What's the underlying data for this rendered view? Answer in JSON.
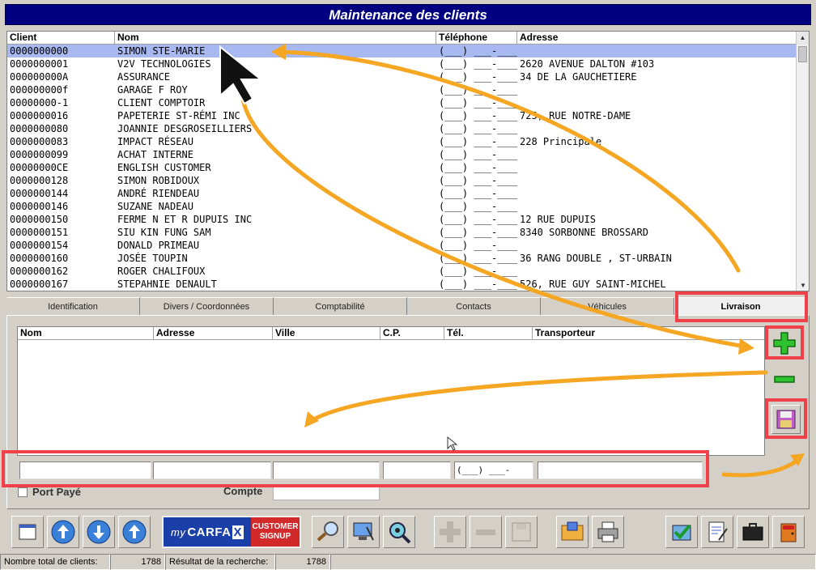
{
  "window": {
    "title": "Maintenance des clients"
  },
  "client_grid": {
    "columns": [
      "Client",
      "Nom",
      "Téléphone",
      "Adresse"
    ],
    "rows": [
      {
        "client": "0000000000",
        "nom": "SIMON STE-MARIE",
        "tel": "(___) ___-____",
        "adresse": ""
      },
      {
        "client": "0000000001",
        "nom": "V2V TECHNOLOGIES",
        "tel": "(___) ___-____",
        "adresse": "2620 AVENUE DALTON #103"
      },
      {
        "client": "000000000A",
        "nom": "ASSURANCE",
        "tel": "(___) ___-____",
        "adresse": "34 DE LA GAUCHETIERE"
      },
      {
        "client": "000000000f",
        "nom": "GARAGE F ROY",
        "tel": "(___) ___-____",
        "adresse": ""
      },
      {
        "client": "00000000-1",
        "nom": "CLIENT COMPTOIR",
        "tel": "(___) ___-____",
        "adresse": ""
      },
      {
        "client": "0000000016",
        "nom": "PAPETERIE ST-RÉMI INC",
        "tel": "(___) ___-____",
        "adresse": "725, RUE NOTRE-DAME"
      },
      {
        "client": "0000000080",
        "nom": "JOANNIE DESGROSEILLIERS",
        "tel": "(___) ___-____",
        "adresse": ""
      },
      {
        "client": "0000000083",
        "nom": "IMPACT RÉSEAU",
        "tel": "(___) ___-____",
        "adresse": "228 Principale"
      },
      {
        "client": "0000000099",
        "nom": "ACHAT INTERNE",
        "tel": "(___) ___-____",
        "adresse": ""
      },
      {
        "client": "00000000CE",
        "nom": "ENGLISH CUSTOMER",
        "tel": "(___) ___-____",
        "adresse": ""
      },
      {
        "client": "0000000128",
        "nom": "SIMON ROBIDOUX",
        "tel": "(___) ___-____",
        "adresse": ""
      },
      {
        "client": "0000000144",
        "nom": "ANDRÉ RIENDEAU",
        "tel": "(___) ___-____",
        "adresse": ""
      },
      {
        "client": "0000000146",
        "nom": "SUZANE NADEAU",
        "tel": "(___) ___-____",
        "adresse": ""
      },
      {
        "client": "0000000150",
        "nom": "FERME N ET R DUPUIS INC",
        "tel": "(___) ___-____",
        "adresse": "12 RUE DUPUIS"
      },
      {
        "client": "0000000151",
        "nom": "SIU KIN FUNG SAM",
        "tel": "(___) ___-____",
        "adresse": "8340 SORBONNE BROSSARD"
      },
      {
        "client": "0000000154",
        "nom": "DONALD PRIMEAU",
        "tel": "(___) ___-____",
        "adresse": ""
      },
      {
        "client": "0000000160",
        "nom": "JOSÉE TOUPIN",
        "tel": "(___) ___-____",
        "adresse": "36 RANG DOUBLE , ST-URBAIN"
      },
      {
        "client": "0000000162",
        "nom": "ROGER CHALIFOUX",
        "tel": "(___) ___-____",
        "adresse": ""
      },
      {
        "client": "0000000167",
        "nom": "STEPAHNIE DENAULT",
        "tel": "(___) ___-____",
        "adresse": "526, RUE GUY SAINT-MICHEL"
      }
    ]
  },
  "tabs": [
    "Identification",
    "Divers / Coordonnées",
    "Comptabilité",
    "Contacts",
    "Véhicules",
    "Livraison"
  ],
  "livraison_grid": {
    "columns": [
      "Nom",
      "Adresse",
      "Ville",
      "C.P.",
      "Tél.",
      "Transporteur"
    ]
  },
  "entry": {
    "tel_mask": "(___) ___-____"
  },
  "options": {
    "port_paye_label": "Port Payé",
    "compte_label": "Compte"
  },
  "carfax": {
    "my": "my",
    "logo_carfa": "CARFA",
    "logo_x": "X",
    "signup_line1": "CUSTOMER",
    "signup_line2": "SIGNUP"
  },
  "status": {
    "total_label": "Nombre total de clients:",
    "total_value": "1788",
    "result_label": "Résultat de la recherche:",
    "result_value": "1788"
  },
  "colors": {
    "title_bg": "#000080",
    "selected_row": "#a8b8f0",
    "highlight": "#f0404a",
    "arrow": "#f5a623"
  }
}
